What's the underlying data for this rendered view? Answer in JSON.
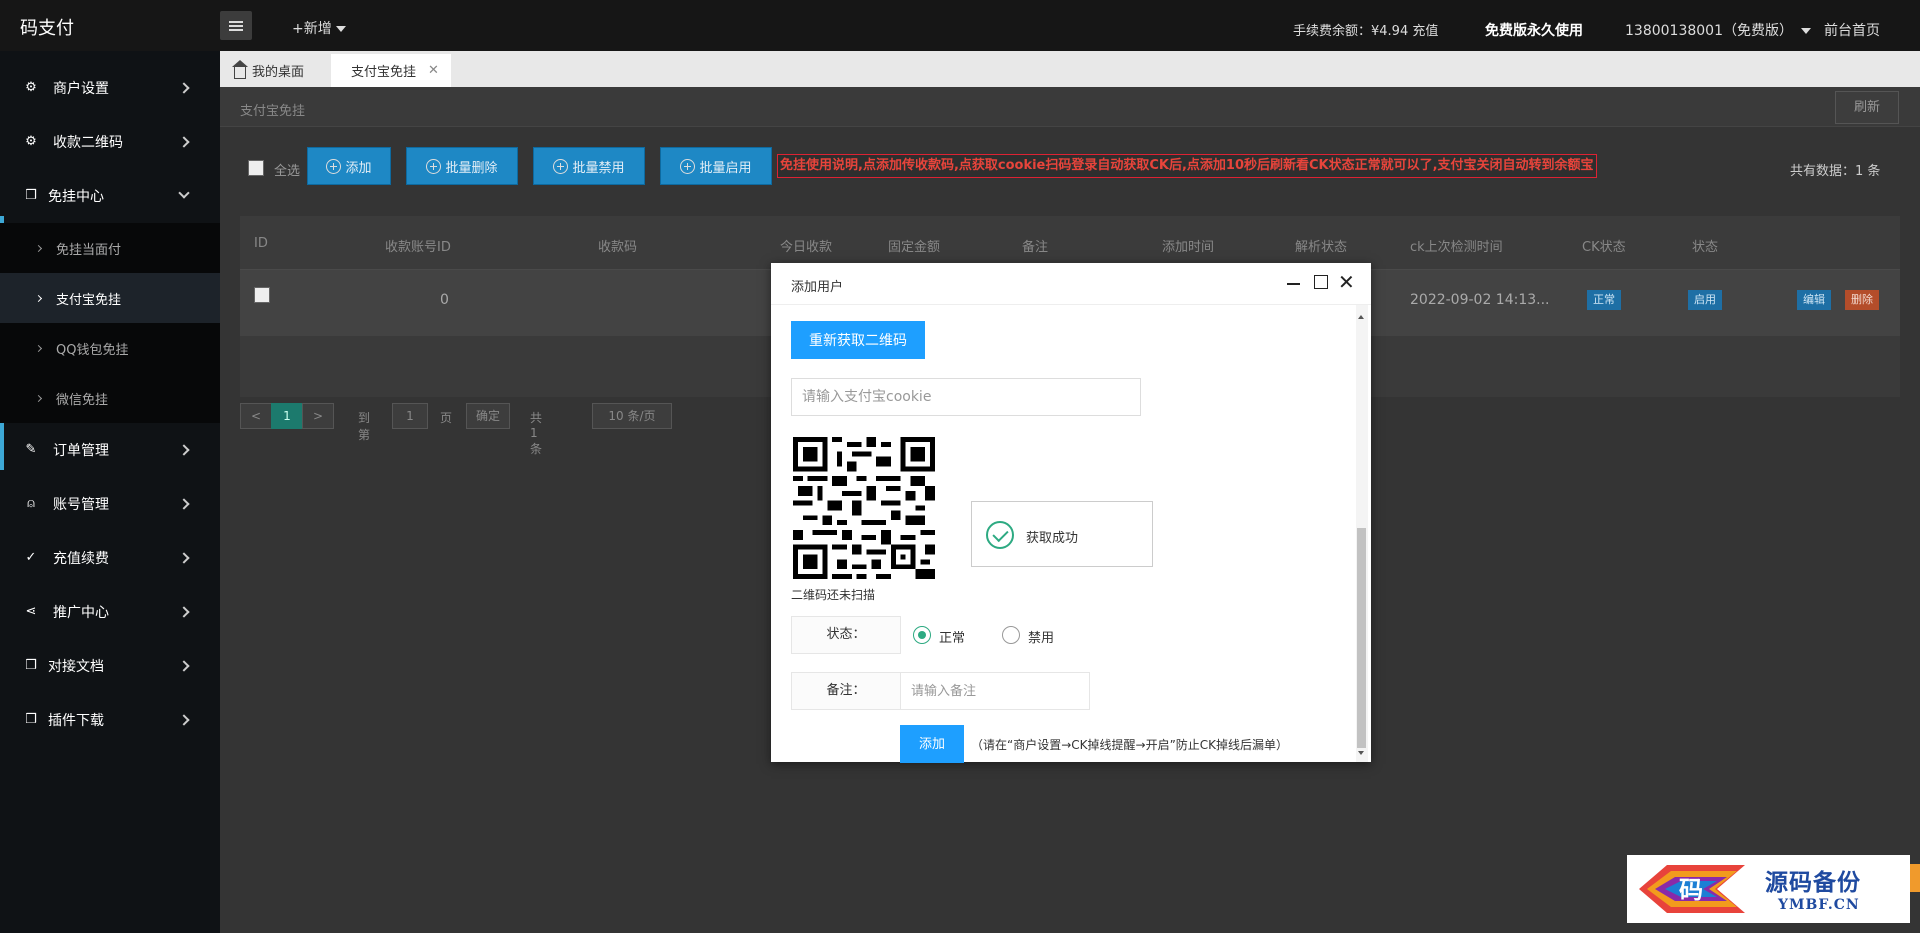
{
  "app": {
    "logo": "码支付",
    "new_label": "+新增",
    "fee_text": "手续费余额：¥4.94 充值",
    "plan_text": "免费版永久使用",
    "user_text": "13800138001（免费版）",
    "home_link": "前台首页"
  },
  "sidebar": {
    "items": [
      {
        "label": "商户设置",
        "icon": "gear-icon"
      },
      {
        "label": "收款二维码",
        "icon": "gear-icon"
      },
      {
        "label": "免挂中心",
        "icon": "cube-icon"
      },
      {
        "label": "订单管理",
        "icon": "edit-icon"
      },
      {
        "label": "账号管理",
        "icon": "user-icon"
      },
      {
        "label": "充值续费",
        "icon": "check-icon"
      },
      {
        "label": "推广中心",
        "icon": "share-icon"
      },
      {
        "label": "对接文档",
        "icon": "cube-icon"
      },
      {
        "label": "插件下载",
        "icon": "cube-icon"
      }
    ],
    "subitems": [
      {
        "label": "免挂当面付"
      },
      {
        "label": "支付宝免挂"
      },
      {
        "label": "QQ钱包免挂"
      },
      {
        "label": "微信免挂"
      }
    ]
  },
  "tabs": [
    {
      "label": "我的桌面"
    },
    {
      "label": "支付宝免挂"
    }
  ],
  "breadcrumb": "支付宝免挂",
  "refresh_label": "刷新",
  "toolbar": {
    "select_all": "全选",
    "add": "添加",
    "batch_delete": "批量删除",
    "batch_disable": "批量禁用",
    "batch_enable": "批量启用",
    "notice": "免挂使用说明,点添加传收款码,点获取cookie扫码登录自动获取CK后,点添加10秒后刷新看CK状态正常就可以了,支付宝关闭自动转到余额宝",
    "total": "共有数据：1 条"
  },
  "table": {
    "headers": [
      "ID",
      "收款账号ID",
      "收款码",
      "今日收款",
      "固定金额",
      "备注",
      "添加时间",
      "解析状态",
      "ck上次检测时间",
      "CK状态",
      "状态"
    ],
    "row": {
      "account_id": "0",
      "ck_time": "2022-09-02 14:13...",
      "ck_status": "正常",
      "status": "启用",
      "edit": "编辑",
      "delete": "删除"
    }
  },
  "pager": {
    "prev": "<",
    "current": "1",
    "next": ">",
    "goto_label": "到第",
    "page_value": "1",
    "page_unit": "页",
    "confirm": "确定",
    "total": "共 1 条",
    "per_page": "10 条/页"
  },
  "modal": {
    "title": "添加用户",
    "regen_qr": "重新获取二维码",
    "cookie_placeholder": "请输入支付宝cookie",
    "qr_caption": "二维码还未扫描",
    "success_text": "获取成功",
    "status_label": "状态：",
    "status_normal": "正常",
    "status_disabled": "禁用",
    "remark_label": "备注：",
    "remark_placeholder": "请输入备注",
    "submit": "添加",
    "tip": "（请在“商户设置→CK掉线提醒→开启”防止CK掉线后漏单）"
  },
  "watermark": {
    "logo_char": "码",
    "cn": "源码备份",
    "en": "YMBF.CN"
  }
}
